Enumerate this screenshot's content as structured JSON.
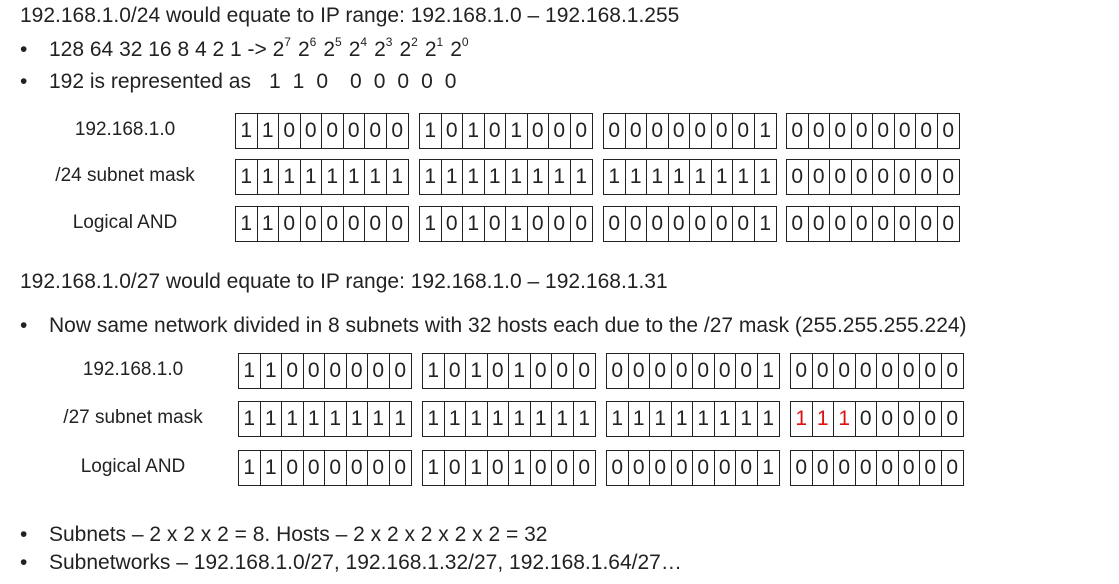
{
  "section1": {
    "heading": "192.168.1.0/24 would equate to IP range: 192.168.1.0 – 192.168.1.255",
    "bullet_dot": "•",
    "bullet1_prefix": "128 64 32 16 8 4 2 1 -> ",
    "powers": [
      {
        "base": "2",
        "exp": "7"
      },
      {
        "base": "2",
        "exp": "6"
      },
      {
        "base": "2",
        "exp": "5"
      },
      {
        "base": "2",
        "exp": "4"
      },
      {
        "base": "2",
        "exp": "3"
      },
      {
        "base": "2",
        "exp": "2"
      },
      {
        "base": "2",
        "exp": "1"
      },
      {
        "base": "2",
        "exp": "0"
      }
    ],
    "bullet2_prefix": "192 is represented as",
    "bullet2_bits": [
      "1",
      "1",
      "0",
      "0",
      "0",
      "0",
      "0",
      "0"
    ],
    "rows": [
      {
        "label": "192.168.1.0",
        "octets": [
          "11000000",
          "10101000",
          "00000001",
          "00000000"
        ]
      },
      {
        "label": "/24 subnet mask",
        "octets": [
          "11111111",
          "11111111",
          "11111111",
          "00000000"
        ]
      },
      {
        "label": "Logical AND",
        "octets": [
          "11000000",
          "10101000",
          "00000001",
          "00000000"
        ]
      }
    ]
  },
  "section2": {
    "heading": "192.168.1.0/27 would equate to IP range: 192.168.1.0 – 192.168.1.31",
    "bullet1": "Now same network divided in 8 subnets with 32 hosts each due to the /27 mask (255.255.255.224)",
    "rows": [
      {
        "label": "192.168.1.0",
        "octets": [
          "11000000",
          "10101000",
          "00000001",
          "00000000"
        ]
      },
      {
        "label": "/27 subnet mask",
        "octets": [
          "11111111",
          "11111111",
          "11111111",
          "11100000"
        ],
        "highlight_octet": 3,
        "highlight_bits": 3
      },
      {
        "label": "Logical AND",
        "octets": [
          "11000000",
          "10101000",
          "00000001",
          "00000000"
        ]
      }
    ]
  },
  "footer": {
    "bullet1": "Subnets – 2 x 2 x 2 = 8. Hosts – 2 x 2 x 2 x 2 x 2 = 32",
    "bullet2": "Subnetworks – 192.168.1.0/27, 192.168.1.32/27, 192.168.1.64/27…"
  },
  "colors": {
    "text": "#222222",
    "highlight": "#e01010",
    "grid": "#222222"
  }
}
